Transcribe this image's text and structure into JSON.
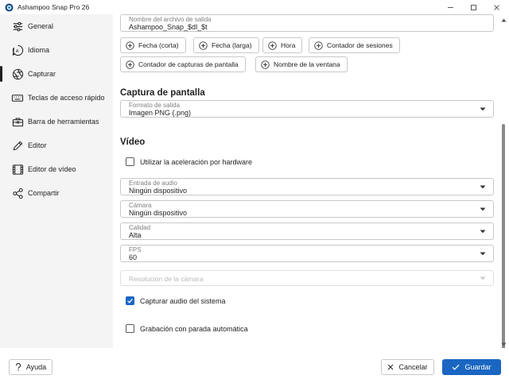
{
  "window": {
    "title": "Ashampoo Snap Pro 26",
    "icons": {
      "app": "ashampoo-snap-icon",
      "minimize": "minimize-icon",
      "maximize": "maximize-icon",
      "close": "close-icon"
    }
  },
  "sidebar": {
    "items": [
      {
        "label": "General",
        "icon": "sliders-icon"
      },
      {
        "label": "Idioma",
        "icon": "language-icon"
      },
      {
        "label": "Capturar",
        "icon": "aperture-icon",
        "active": true
      },
      {
        "label": "Teclas de acceso rápido",
        "icon": "keyboard-icon"
      },
      {
        "label": "Barra de herramientas",
        "icon": "toolbox-icon"
      },
      {
        "label": "Editor",
        "icon": "pencil-icon"
      },
      {
        "label": "Editor de vídeo",
        "icon": "video-editor-icon"
      },
      {
        "label": "Compartir",
        "icon": "share-icon"
      }
    ]
  },
  "filename": {
    "label": "Nombre del archivo de salida",
    "value": "Ashampoo_Snap_$dl_$t"
  },
  "tokens": [
    "Fecha (corta)",
    "Fecha (larga)",
    "Hora",
    "Contador de sesiones",
    "Contador de capturas de pantalla",
    "Nombre de la ventana"
  ],
  "screenshot": {
    "title": "Captura de pantalla",
    "format": {
      "label": "Formato de salida",
      "value": "Imagen PNG (.png)"
    }
  },
  "video": {
    "title": "Vídeo",
    "hw_accel": {
      "label": "Utilizar la aceleración por hardware",
      "checked": false
    },
    "audio_input": {
      "label": "Entrada de audio",
      "value": "Ningún dispositivo"
    },
    "camera": {
      "label": "Cámara",
      "value": "Ningún dispositivo"
    },
    "quality": {
      "label": "Calidad",
      "value": "Alta"
    },
    "fps": {
      "label": "FPS",
      "value": "60"
    },
    "camera_resolution": {
      "label": "Resolución de la cámara",
      "value": ""
    },
    "system_audio": {
      "label": "Capturar audio del sistema",
      "checked": true
    },
    "auto_stop": {
      "label": "Grabación con parada automática",
      "checked": false
    }
  },
  "footer": {
    "help": "Ayuda",
    "cancel": "Cancelar",
    "save": "Guardar"
  },
  "colors": {
    "accent": "#1a66c2",
    "sidebar_bg": "#f4f4f4",
    "border": "#c8c8c8"
  }
}
